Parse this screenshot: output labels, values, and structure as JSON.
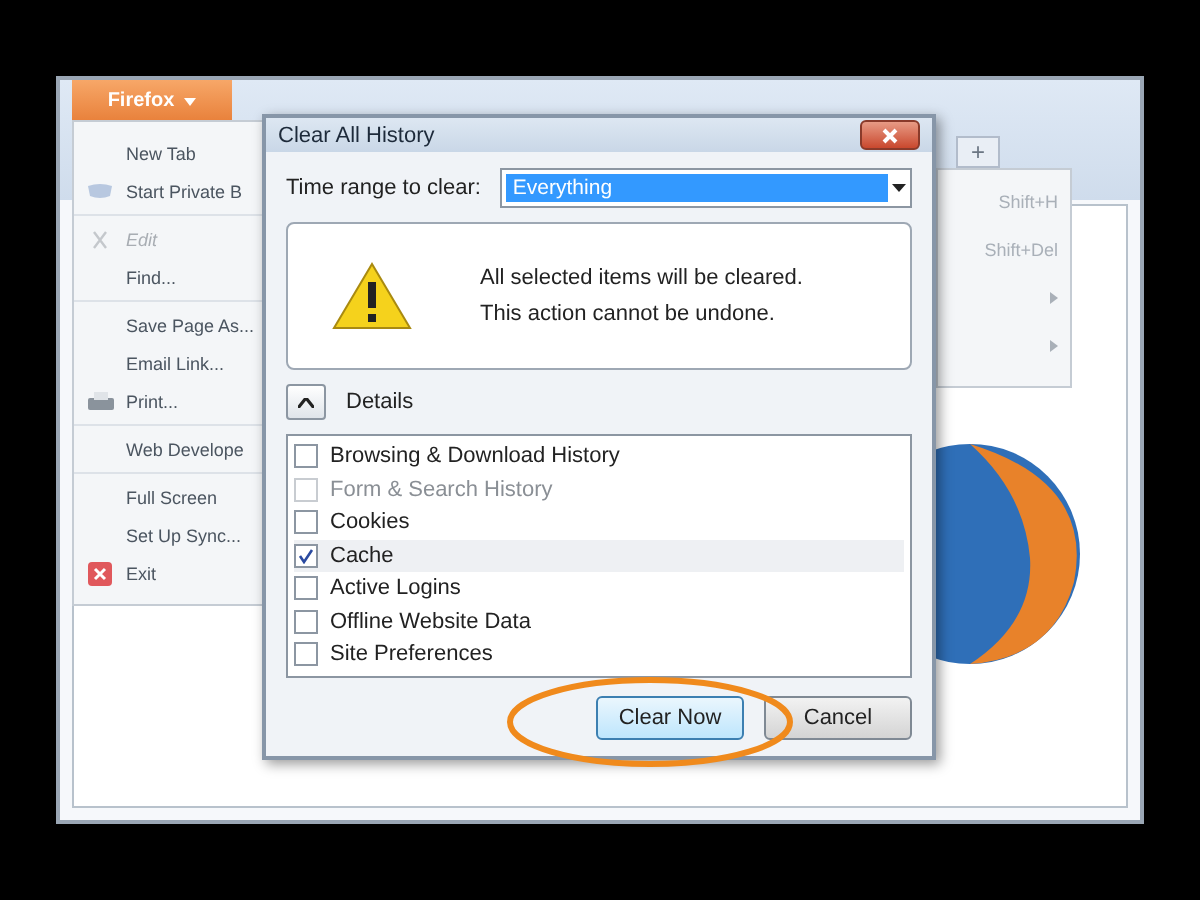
{
  "browser": {
    "menu_button": "Firefox",
    "new_tab_button": "+"
  },
  "app_menu": {
    "groups": [
      [
        {
          "label": "New Tab",
          "kind": "plain",
          "disabled": false
        },
        {
          "label": "Start Private B",
          "kind": "private",
          "disabled": false
        }
      ],
      [
        {
          "label": "Edit",
          "kind": "edit",
          "disabled": true
        },
        {
          "label": "Find...",
          "kind": "plain",
          "disabled": false
        }
      ],
      [
        {
          "label": "Save Page As...",
          "kind": "plain",
          "disabled": false
        },
        {
          "label": "Email Link...",
          "kind": "plain",
          "disabled": false
        },
        {
          "label": "Print...",
          "kind": "print",
          "disabled": false
        }
      ],
      [
        {
          "label": "Web Develope",
          "kind": "plain",
          "disabled": false
        }
      ],
      [
        {
          "label": "Full Screen",
          "kind": "plain",
          "disabled": false
        },
        {
          "label": "Set Up Sync...",
          "kind": "plain",
          "disabled": false
        },
        {
          "label": "Exit",
          "kind": "exit",
          "disabled": false
        }
      ]
    ]
  },
  "side_menu": {
    "items": [
      {
        "kind": "shortcut",
        "label": "Shift+H"
      },
      {
        "kind": "shortcut",
        "label": "Shift+Del"
      },
      {
        "kind": "submenu"
      },
      {
        "kind": "submenu"
      }
    ]
  },
  "dialog": {
    "title": "Clear All History",
    "time_range": {
      "label": "Time range to clear:",
      "value": "Everything"
    },
    "warning": [
      "All selected items will be cleared.",
      "This action cannot be undone."
    ],
    "details": {
      "label": "Details",
      "expanded": true
    },
    "items": [
      {
        "label": "Browsing & Download History",
        "checked": false,
        "disabled": false,
        "selected": false
      },
      {
        "label": "Form & Search History",
        "checked": false,
        "disabled": true,
        "selected": false
      },
      {
        "label": "Cookies",
        "checked": false,
        "disabled": false,
        "selected": false
      },
      {
        "label": "Cache",
        "checked": true,
        "disabled": false,
        "selected": true
      },
      {
        "label": "Active Logins",
        "checked": false,
        "disabled": false,
        "selected": false
      },
      {
        "label": "Offline Website Data",
        "checked": false,
        "disabled": false,
        "selected": false
      },
      {
        "label": "Site Preferences",
        "checked": false,
        "disabled": false,
        "selected": false
      }
    ],
    "buttons": [
      {
        "label": "Clear Now",
        "default": true,
        "highlighted": true
      },
      {
        "label": "Cancel",
        "default": false,
        "highlighted": false
      }
    ]
  }
}
